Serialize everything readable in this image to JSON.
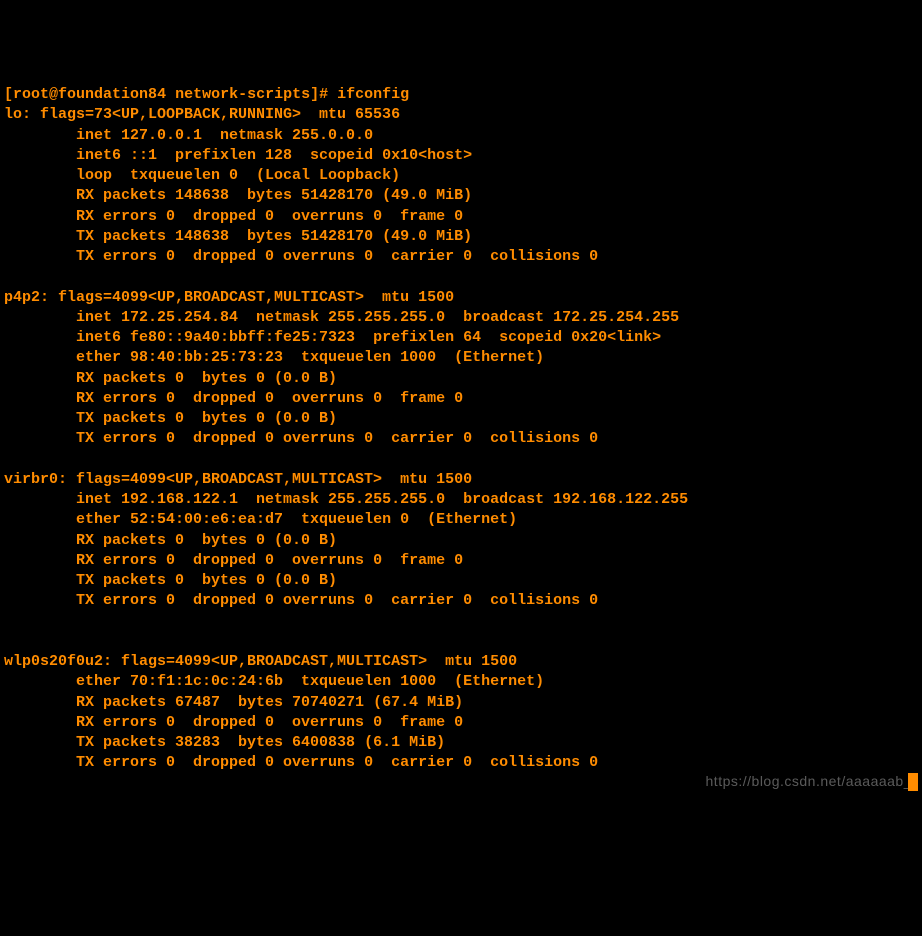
{
  "prompt": {
    "user": "root",
    "host": "foundation84",
    "cwd": "network-scripts",
    "command": "ifconfig"
  },
  "interfaces": {
    "lo": {
      "header": "lo: flags=73<UP,LOOPBACK,RUNNING>  mtu 65536",
      "lines": [
        "inet 127.0.0.1  netmask 255.0.0.0",
        "inet6 ::1  prefixlen 128  scopeid 0x10<host>",
        "loop  txqueuelen 0  (Local Loopback)",
        "RX packets 148638  bytes 51428170 (49.0 MiB)",
        "RX errors 0  dropped 0  overruns 0  frame 0",
        "TX packets 148638  bytes 51428170 (49.0 MiB)",
        "TX errors 0  dropped 0 overruns 0  carrier 0  collisions 0"
      ]
    },
    "p4p2": {
      "header": "p4p2: flags=4099<UP,BROADCAST,MULTICAST>  mtu 1500",
      "lines": [
        "inet 172.25.254.84  netmask 255.255.255.0  broadcast 172.25.254.255",
        "inet6 fe80::9a40:bbff:fe25:7323  prefixlen 64  scopeid 0x20<link>",
        "ether 98:40:bb:25:73:23  txqueuelen 1000  (Ethernet)",
        "RX packets 0  bytes 0 (0.0 B)",
        "RX errors 0  dropped 0  overruns 0  frame 0",
        "TX packets 0  bytes 0 (0.0 B)",
        "TX errors 0  dropped 0 overruns 0  carrier 0  collisions 0"
      ]
    },
    "virbr0": {
      "header": "virbr0: flags=4099<UP,BROADCAST,MULTICAST>  mtu 1500",
      "lines": [
        "inet 192.168.122.1  netmask 255.255.255.0  broadcast 192.168.122.255",
        "ether 52:54:00:e6:ea:d7  txqueuelen 0  (Ethernet)",
        "RX packets 0  bytes 0 (0.0 B)",
        "RX errors 0  dropped 0  overruns 0  frame 0",
        "TX packets 0  bytes 0 (0.0 B)",
        "TX errors 0  dropped 0 overruns 0  carrier 0  collisions 0"
      ]
    },
    "wlp0s20f0u2": {
      "header": "wlp0s20f0u2: flags=4099<UP,BROADCAST,MULTICAST>  mtu 1500",
      "lines": [
        "ether 70:f1:1c:0c:24:6b  txqueuelen 1000  (Ethernet)",
        "RX packets 67487  bytes 70740271 (67.4 MiB)",
        "RX errors 0  dropped 0  overruns 0  frame 0",
        "TX packets 38283  bytes 6400838 (6.1 MiB)",
        "TX errors 0  dropped 0 overruns 0  carrier 0  collisions 0"
      ]
    }
  },
  "watermark": "https://blog.csdn.net/aaaaaab_"
}
